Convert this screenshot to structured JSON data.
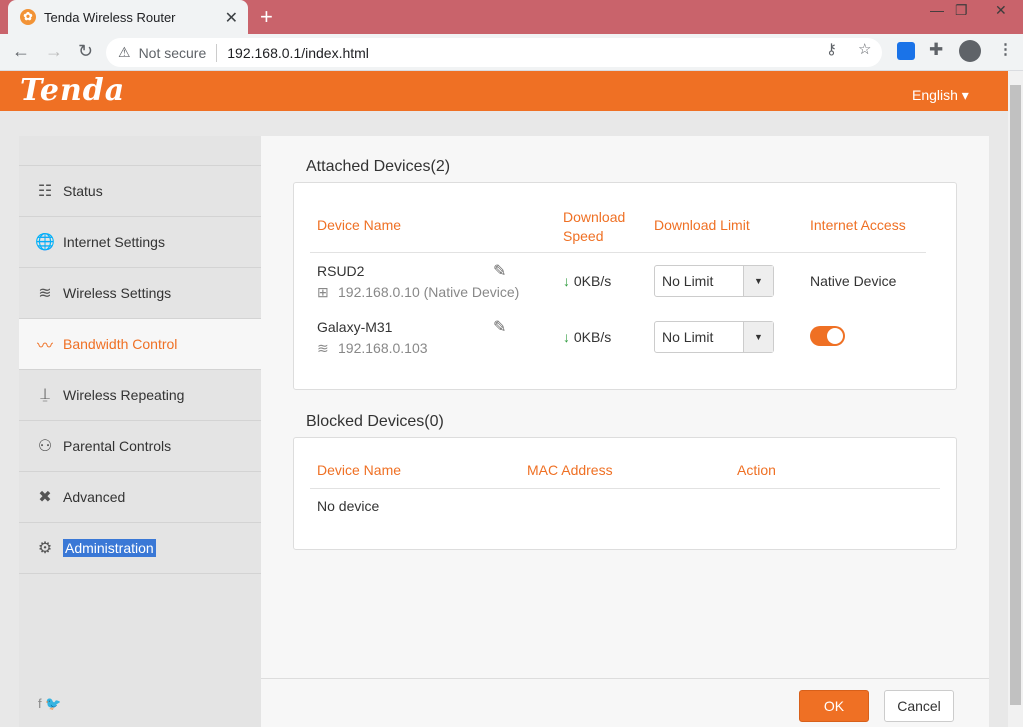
{
  "browser": {
    "tab_title": "Tenda Wireless Router",
    "tab_close": "✕",
    "new_tab": "+",
    "security_label": "Not secure",
    "url": "192.168.0.1/index.html",
    "window_controls": {
      "minimize": "—",
      "restore": "❐",
      "close": "✕"
    }
  },
  "header": {
    "logo": "Tenda",
    "language": "English ▾"
  },
  "sidebar": {
    "items": [
      {
        "label": "Status",
        "icon": "router-icon",
        "glyph": "☷"
      },
      {
        "label": "Internet Settings",
        "icon": "globe-icon",
        "glyph": "🌐"
      },
      {
        "label": "Wireless Settings",
        "icon": "wifi-icon",
        "glyph": "≋"
      },
      {
        "label": "Bandwidth Control",
        "icon": "chart-line-icon",
        "glyph": "〰"
      },
      {
        "label": "Wireless Repeating",
        "icon": "antenna-icon",
        "glyph": "⍊"
      },
      {
        "label": "Parental Controls",
        "icon": "family-icon",
        "glyph": "⚇"
      },
      {
        "label": "Advanced",
        "icon": "tools-icon",
        "glyph": "✖"
      },
      {
        "label": "Administration",
        "icon": "gears-icon",
        "glyph": "⚙"
      }
    ],
    "active_index": 3,
    "social": "f  🐦"
  },
  "attached": {
    "title": "Attached Devices(2)",
    "columns": {
      "device_name": "Device Name",
      "download_speed": "Download\nSpeed",
      "download_limit": "Download Limit",
      "internet_access": "Internet Access"
    },
    "devices": [
      {
        "name": "RSUD2",
        "ip": "192.168.0.10 (Native Device)",
        "speed": "0KB/s",
        "limit": "No Limit",
        "access": "Native Device"
      },
      {
        "name": "Galaxy-M31",
        "ip": "192.168.0.103",
        "speed": "0KB/s",
        "limit": "No Limit",
        "access_toggle": true
      }
    ]
  },
  "blocked": {
    "title": "Blocked Devices(0)",
    "columns": {
      "device_name": "Device Name",
      "mac": "MAC Address",
      "action": "Action"
    },
    "empty": "No device"
  },
  "footer": {
    "ok": "OK",
    "cancel": "Cancel"
  },
  "colors": {
    "accent": "#ef7024",
    "speed_arrow": "#2e9b3d",
    "selection": "#3a78d6"
  }
}
